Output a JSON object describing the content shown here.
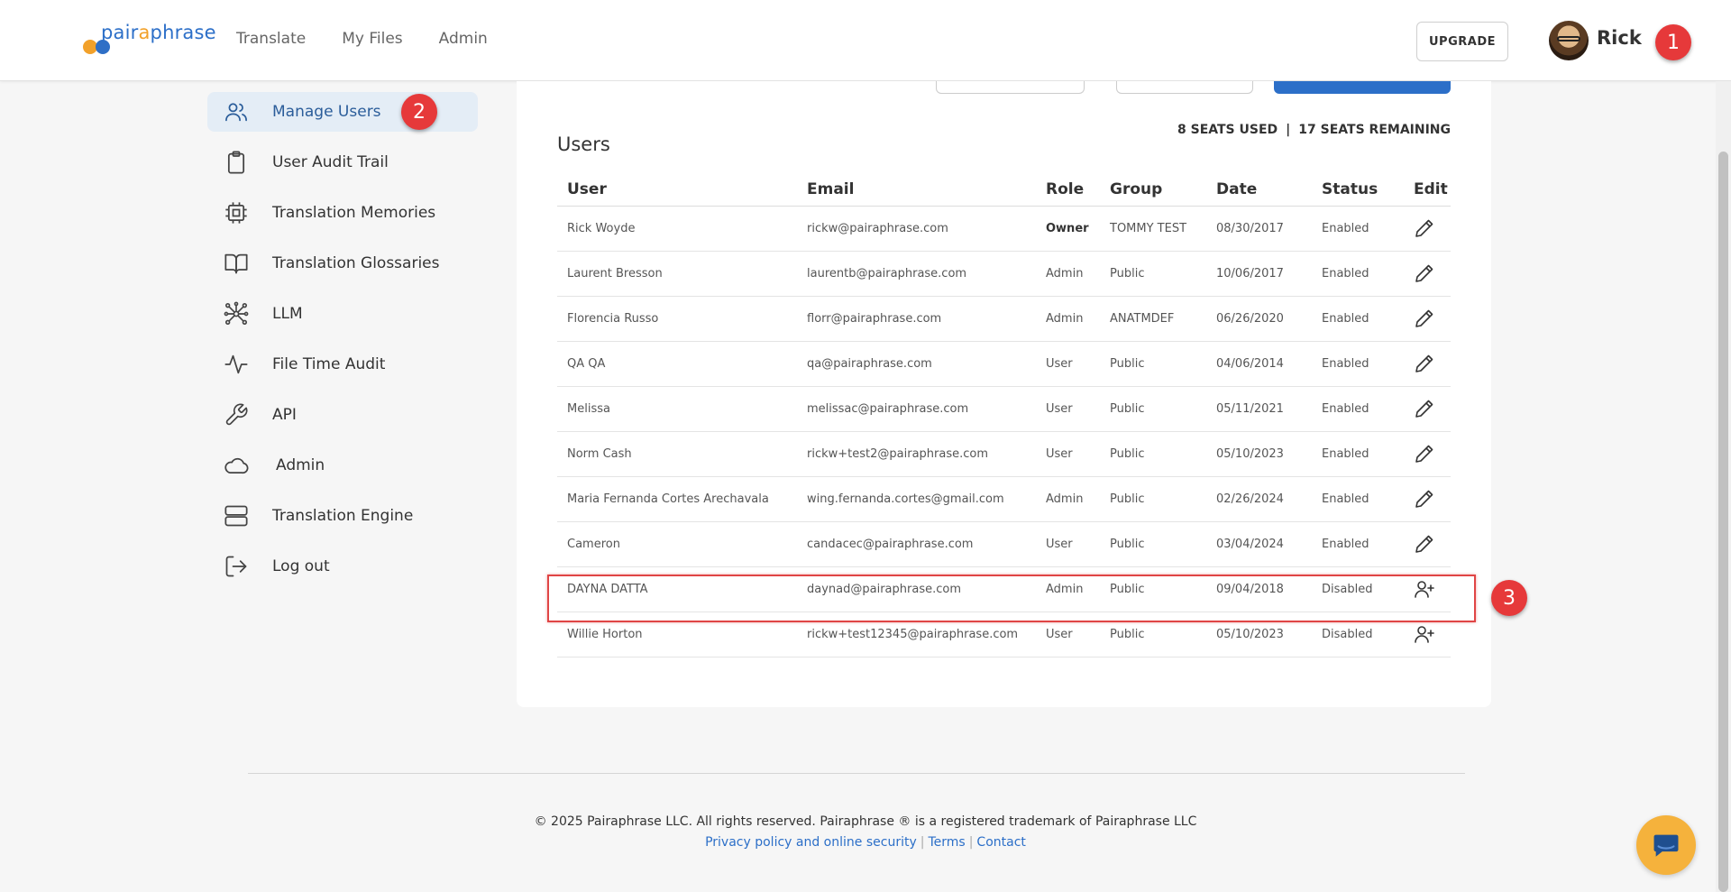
{
  "brand": {
    "logo_prefix": "pair",
    "logo_accent": "a",
    "logo_suffix": "phrase",
    "primary_color": "#2c6fc8",
    "accent_color": "#f2a12a"
  },
  "nav": {
    "items": [
      {
        "label": "Translate"
      },
      {
        "label": "My Files"
      },
      {
        "label": "Admin"
      }
    ]
  },
  "header": {
    "upgrade_label": "UPGRADE",
    "user_name": "Rick"
  },
  "badges": {
    "b1": "1",
    "b2": "2",
    "b3": "3"
  },
  "sidebar": {
    "items": [
      {
        "label": "Manage Users",
        "icon": "users-icon",
        "active": true
      },
      {
        "label": "User Audit Trail",
        "icon": "clipboard-icon"
      },
      {
        "label": "Translation Memories",
        "icon": "chip-icon"
      },
      {
        "label": "Translation Glossaries",
        "icon": "book-icon"
      },
      {
        "label": "LLM",
        "icon": "network-icon"
      },
      {
        "label": "File Time Audit",
        "icon": "activity-icon"
      },
      {
        "label": "API",
        "icon": "wrench-icon"
      },
      {
        "label": "Admin",
        "icon": "cloud-icon"
      },
      {
        "label": "Translation Engine",
        "icon": "server-icon"
      },
      {
        "label": "Log out",
        "icon": "logout-icon"
      }
    ]
  },
  "users": {
    "title": "Users",
    "seats_used": "8 SEATS USED",
    "seats_sep": "|",
    "seats_remaining": "17 SEATS REMAINING",
    "columns": [
      "User",
      "Email",
      "Role",
      "Group",
      "Date",
      "Status",
      "Edit"
    ],
    "rows": [
      {
        "user": "Rick Woyde",
        "email": "rickw@pairaphrase.com",
        "role": "Owner",
        "group": "TOMMY TEST",
        "date": "08/30/2017",
        "status": "Enabled",
        "action": "edit-icon"
      },
      {
        "user": "Laurent Bresson",
        "email": "laurentb@pairaphrase.com",
        "role": "Admin",
        "group": "Public",
        "date": "10/06/2017",
        "status": "Enabled",
        "action": "edit-icon"
      },
      {
        "user": "Florencia Russo",
        "email": "florr@pairaphrase.com",
        "role": "Admin",
        "group": "ANATMDEF",
        "date": "06/26/2020",
        "status": "Enabled",
        "action": "edit-icon"
      },
      {
        "user": "QA QA",
        "email": "qa@pairaphrase.com",
        "role": "User",
        "group": "Public",
        "date": "04/06/2014",
        "status": "Enabled",
        "action": "edit-icon"
      },
      {
        "user": "Melissa",
        "email": "melissac@pairaphrase.com",
        "role": "User",
        "group": "Public",
        "date": "05/11/2021",
        "status": "Enabled",
        "action": "edit-icon"
      },
      {
        "user": "Norm Cash",
        "email": "rickw+test2@pairaphrase.com",
        "role": "User",
        "group": "Public",
        "date": "05/10/2023",
        "status": "Enabled",
        "action": "edit-icon"
      },
      {
        "user": "Maria Fernanda Cortes Arechavala",
        "email": "wing.fernanda.cortes@gmail.com",
        "role": "Admin",
        "group": "Public",
        "date": "02/26/2024",
        "status": "Enabled",
        "action": "edit-icon"
      },
      {
        "user": "Cameron",
        "email": "candacec@pairaphrase.com",
        "role": "User",
        "group": "Public",
        "date": "03/04/2024",
        "status": "Enabled",
        "action": "edit-icon"
      },
      {
        "user": "DAYNA DATTA",
        "email": "daynad@pairaphrase.com",
        "role": "Admin",
        "group": "Public",
        "date": "09/04/2018",
        "status": "Disabled",
        "action": "add-user-icon"
      },
      {
        "user": "Willie Horton",
        "email": "rickw+test12345@pairaphrase.com",
        "role": "User",
        "group": "Public",
        "date": "05/10/2023",
        "status": "Disabled",
        "action": "add-user-icon"
      }
    ]
  },
  "footer": {
    "copyright": "© 2025 Pairaphrase LLC. All rights reserved. Pairaphrase ® is a registered trademark of Pairaphrase LLC",
    "privacy": "Privacy policy and online security",
    "terms": "Terms",
    "contact": "Contact",
    "pipe": "|"
  }
}
